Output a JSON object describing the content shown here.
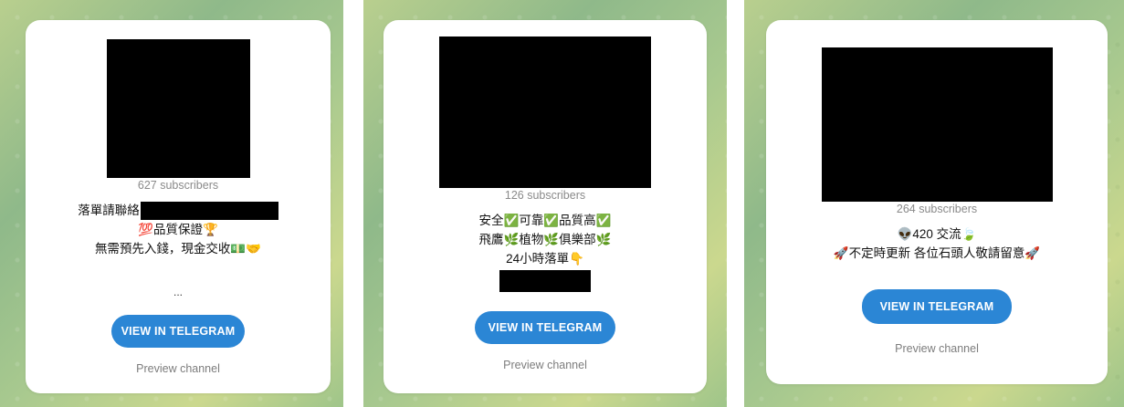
{
  "cards": [
    {
      "subscribers": "627 subscribers",
      "desc_line1": "落單請聯絡",
      "desc_line2": "💯品質保證🏆",
      "desc_line3": "無需預先入錢，現金交收💵🤝",
      "ellipsis": "...",
      "button_label": "VIEW IN TELEGRAM",
      "preview_label": "Preview channel"
    },
    {
      "subscribers": "126 subscribers",
      "desc_line1": "安全✅可靠✅品質高✅",
      "desc_line2": "飛鷹🌿植物🌿俱樂部🌿",
      "desc_line3": "24小時落單👇",
      "button_label": "VIEW IN TELEGRAM",
      "preview_label": "Preview channel"
    },
    {
      "subscribers": "264 subscribers",
      "desc_line1": "👽420 交流🍃",
      "desc_line2": "🚀不定時更新 各位石頭人敬請留意🚀",
      "button_label": "VIEW IN TELEGRAM",
      "preview_label": "Preview channel"
    }
  ],
  "colors": {
    "button": "#2b86d5",
    "subscribers_text": "#8a8a8a",
    "redaction": "#000000"
  }
}
